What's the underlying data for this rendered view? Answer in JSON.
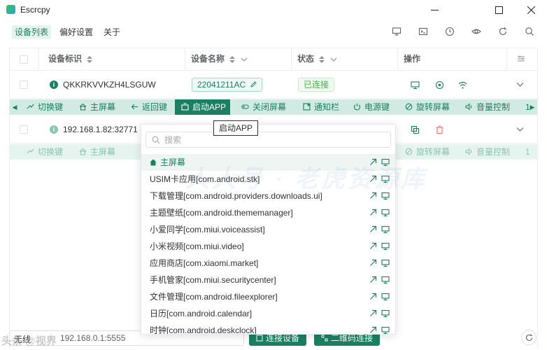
{
  "window": {
    "title": "Escrcpy",
    "controls": [
      "minimize",
      "maximize",
      "close"
    ]
  },
  "menu": {
    "items": [
      {
        "label": "设备列表",
        "active": true
      },
      {
        "label": "偏好设置",
        "active": false
      },
      {
        "label": "关于",
        "active": false
      }
    ],
    "tool_icons": [
      "cast-icon",
      "terminal-icon",
      "clock-icon",
      "eye-icon",
      "refresh-icon",
      "search-icon"
    ]
  },
  "table": {
    "headers": {
      "device_id": "设备标识",
      "device_name": "设备名称",
      "status": "状态",
      "actions": "操作"
    },
    "devices": [
      {
        "id": "QKKRKVVKZH4LSGUW",
        "name": "22041211AC",
        "status": "已连接"
      },
      {
        "id": "192.168.1.82:32771"
      }
    ]
  },
  "toolbar": {
    "items": [
      "切换键",
      "主屏幕",
      "返回键",
      "启动APP",
      "关闭屏幕",
      "通知栏",
      "电源键",
      "旋转屏幕",
      "音量控制"
    ],
    "selected": "启动APP",
    "overflow": "1"
  },
  "tooltip": {
    "text": "启动APP"
  },
  "app_picker": {
    "search_placeholder": "搜索",
    "items": [
      "主屏幕",
      "USIM卡应用[com.android.stk]",
      "下载管理[com.android.providers.downloads.ui]",
      "主题壁纸[com.android.thememanager]",
      "小爱同学[com.miui.voiceassist]",
      "小米视频[com.miui.video]",
      "应用商店[com.xiaomi.market]",
      "手机管家[com.miui.securitycenter]",
      "文件管理[com.android.fileexplorer]",
      "日历[com.android.calendar]",
      "时钟[com.android.deskclock]"
    ]
  },
  "watermark": {
    "text": "人人号 · 老虎资源库"
  },
  "footer": {
    "watermark": "头条 @视界",
    "prefix": "无线",
    "address_value": "192.168.0.1:5555",
    "connect_button": "连接设备",
    "qrcode_button": "二维码连接"
  },
  "colors": {
    "primary": "#1b7f61",
    "toolbar_bg": "#d2ebe2",
    "success": "#41b349",
    "danger": "#f56c6c"
  }
}
